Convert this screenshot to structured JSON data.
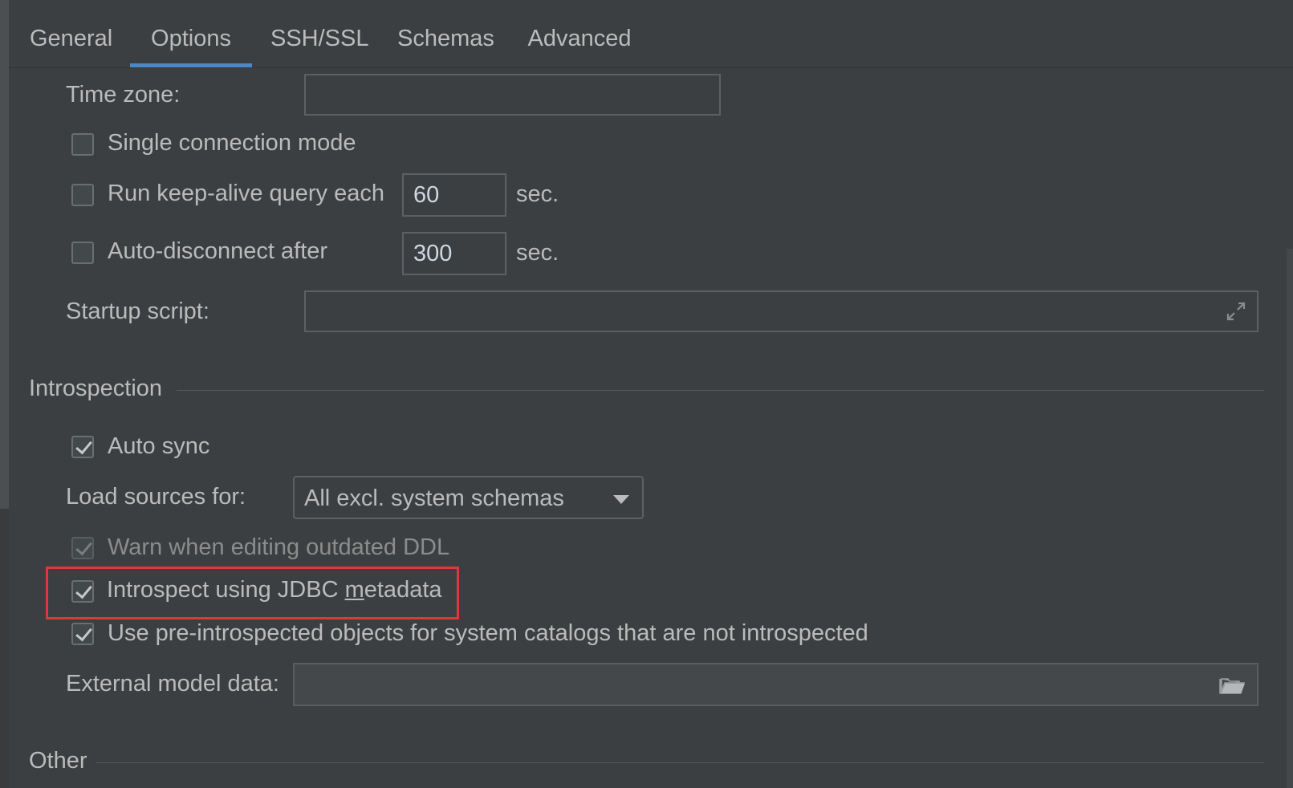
{
  "tabs": [
    {
      "label": "General",
      "active": false
    },
    {
      "label": "Options",
      "active": true
    },
    {
      "label": "SSH/SSL",
      "active": false
    },
    {
      "label": "Schemas",
      "active": false
    },
    {
      "label": "Advanced",
      "active": false
    }
  ],
  "options": {
    "time_zone_label": "Time zone:",
    "time_zone_value": "",
    "single_connection_label": "Single connection mode",
    "single_connection_checked": false,
    "keep_alive_label": "Run keep-alive query each",
    "keep_alive_checked": false,
    "keep_alive_value": "60",
    "keep_alive_unit": "sec.",
    "auto_disconnect_label": "Auto-disconnect after",
    "auto_disconnect_checked": false,
    "auto_disconnect_value": "300",
    "auto_disconnect_unit": "sec.",
    "startup_script_label": "Startup script:",
    "startup_script_value": ""
  },
  "introspection": {
    "title": "Introspection",
    "auto_sync_label": "Auto sync",
    "auto_sync_checked": true,
    "load_sources_label": "Load sources for:",
    "load_sources_value": "All excl. system schemas",
    "warn_outdated_label": "Warn when editing outdated DDL",
    "warn_outdated_checked": true,
    "jdbc_label_prefix": "Introspect using JDBC ",
    "jdbc_label_mnemonic": "m",
    "jdbc_label_suffix": "etadata",
    "jdbc_checked": true,
    "pre_introspected_label": "Use pre-introspected objects for system catalogs that are not introspected",
    "pre_introspected_checked": true,
    "external_model_label": "External model data:",
    "external_model_value": ""
  },
  "other": {
    "title": "Other"
  },
  "icons": {
    "expand": "expand-icon",
    "folder": "folder-open-icon",
    "dropdown": "chevron-down-icon"
  },
  "colors": {
    "background": "#3c3f41",
    "accent": "#4a88c7",
    "highlight": "#e0373b"
  }
}
